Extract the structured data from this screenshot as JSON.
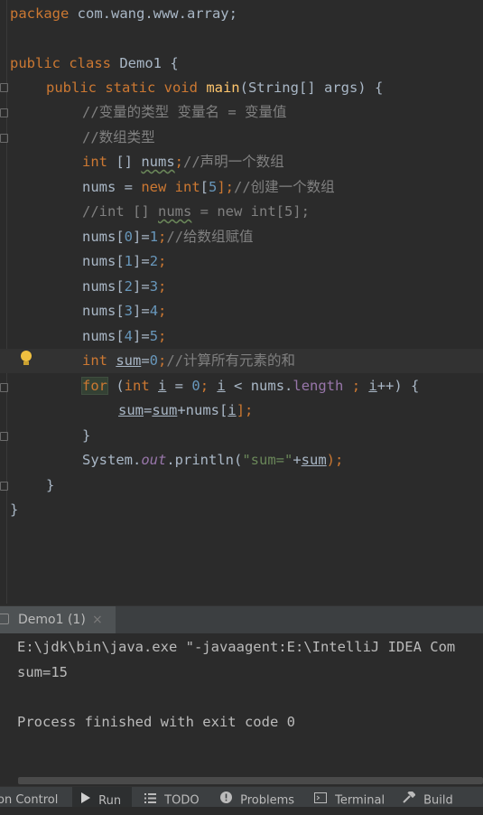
{
  "editor": {
    "lines": {
      "l1_a": "package",
      "l1_b": " com.wang.www.array;",
      "l3_a": "public class ",
      "l3_b": "Demo1 {",
      "l4_a": "public static void ",
      "l4_b": "main",
      "l4_c": "(String[] args) {",
      "l5": "//变量的类型 变量名 = 变量值",
      "l6": "//数组类型",
      "l7_a": "int",
      "l7_b": " [] ",
      "l7_c": "nums",
      "l7_d": ";",
      "l7_e": "//声明一个数组",
      "l8_a": "nums = ",
      "l8_b": "new ",
      "l8_c": "int",
      "l8_d": "[",
      "l8_e": "5",
      "l8_f": "];",
      "l8_g": "//创建一个数组",
      "l9_a": "//int [] ",
      "l9_b": "nums",
      "l9_c": " = new int[5];",
      "l10_a": "nums[",
      "l10_b": "0",
      "l10_c": "]=",
      "l10_d": "1",
      "l10_e": ";",
      "l10_f": "//给数组赋值",
      "l11_a": "nums[",
      "l11_b": "1",
      "l11_c": "]=",
      "l11_d": "2",
      "l11_e": ";",
      "l12_a": "nums[",
      "l12_b": "2",
      "l12_c": "]=",
      "l12_d": "3",
      "l12_e": ";",
      "l13_a": "nums[",
      "l13_b": "3",
      "l13_c": "]=",
      "l13_d": "4",
      "l13_e": ";",
      "l14_a": "nums[",
      "l14_b": "4",
      "l14_c": "]=",
      "l14_d": "5",
      "l14_e": ";",
      "l15_a": "int ",
      "l15_b": "sum",
      "l15_c": "=",
      "l15_d": "0",
      "l15_e": ";",
      "l15_f": "//计算所有元素的和",
      "l16_a": "for",
      "l16_b": " (",
      "l16_c": "int ",
      "l16_d": "i",
      "l16_e": " = ",
      "l16_f": "0",
      "l16_g": "; ",
      "l16_h": "i",
      "l16_i": " < nums.",
      "l16_j": "length",
      "l16_k": " ; ",
      "l16_l": "i",
      "l16_m": "++) {",
      "l17_a": "sum",
      "l17_b": "=",
      "l17_c": "sum",
      "l17_d": "+nums[",
      "l17_e": "i",
      "l17_f": "];",
      "l18": "}",
      "l19_a": "System.",
      "l19_b": "out",
      "l19_c": ".println(",
      "l19_d": "\"sum=\"",
      "l19_e": "+",
      "l19_f": "sum",
      "l19_g": ");",
      "l20": "}",
      "l21": "}"
    }
  },
  "run_panel": {
    "tab_label": "Demo1 (1)",
    "close_symbol": "×",
    "output": [
      "E:\\jdk\\bin\\java.exe \"-javaagent:E:\\IntelliJ IDEA Com",
      "sum=15",
      "",
      "Process finished with exit code 0"
    ]
  },
  "status_bar": {
    "version_control": "on Control",
    "run": "Run",
    "todo": "TODO",
    "problems": "Problems",
    "terminal": "Terminal",
    "build": "Build"
  },
  "colors": {
    "background": "#2b2b2b",
    "keyword": "#cc7832",
    "comment": "#808080",
    "number": "#6897bb",
    "string": "#6a8759",
    "method": "#ffc66d",
    "field": "#9876aa"
  }
}
